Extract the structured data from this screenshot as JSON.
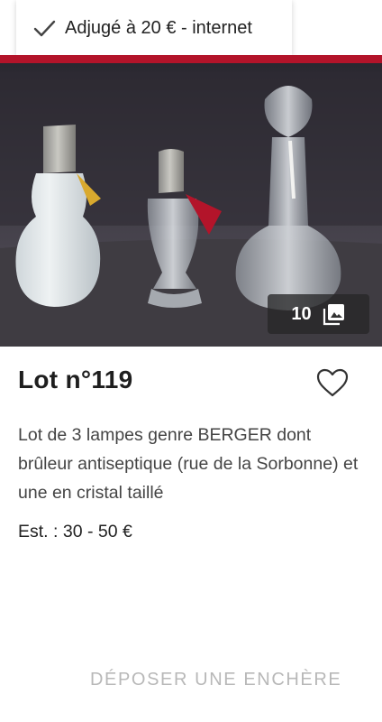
{
  "status": {
    "icon": "check-icon",
    "label": "Adjugé à 20 € - internet"
  },
  "accent_color": "#b3142a",
  "photo": {
    "count": "10",
    "count_icon": "image-gallery-icon"
  },
  "lot": {
    "title": "Lot n°119",
    "description": "Lot de 3 lampes genre BERGER dont brûleur antiseptique (rue de la Sorbonne) et une en cristal taillé",
    "estimate": "Est. : 30 - 50 €"
  },
  "actions": {
    "favorite_icon": "heart-outline-icon",
    "bid_label": "DÉPOSER UNE ENCHÈRE"
  }
}
